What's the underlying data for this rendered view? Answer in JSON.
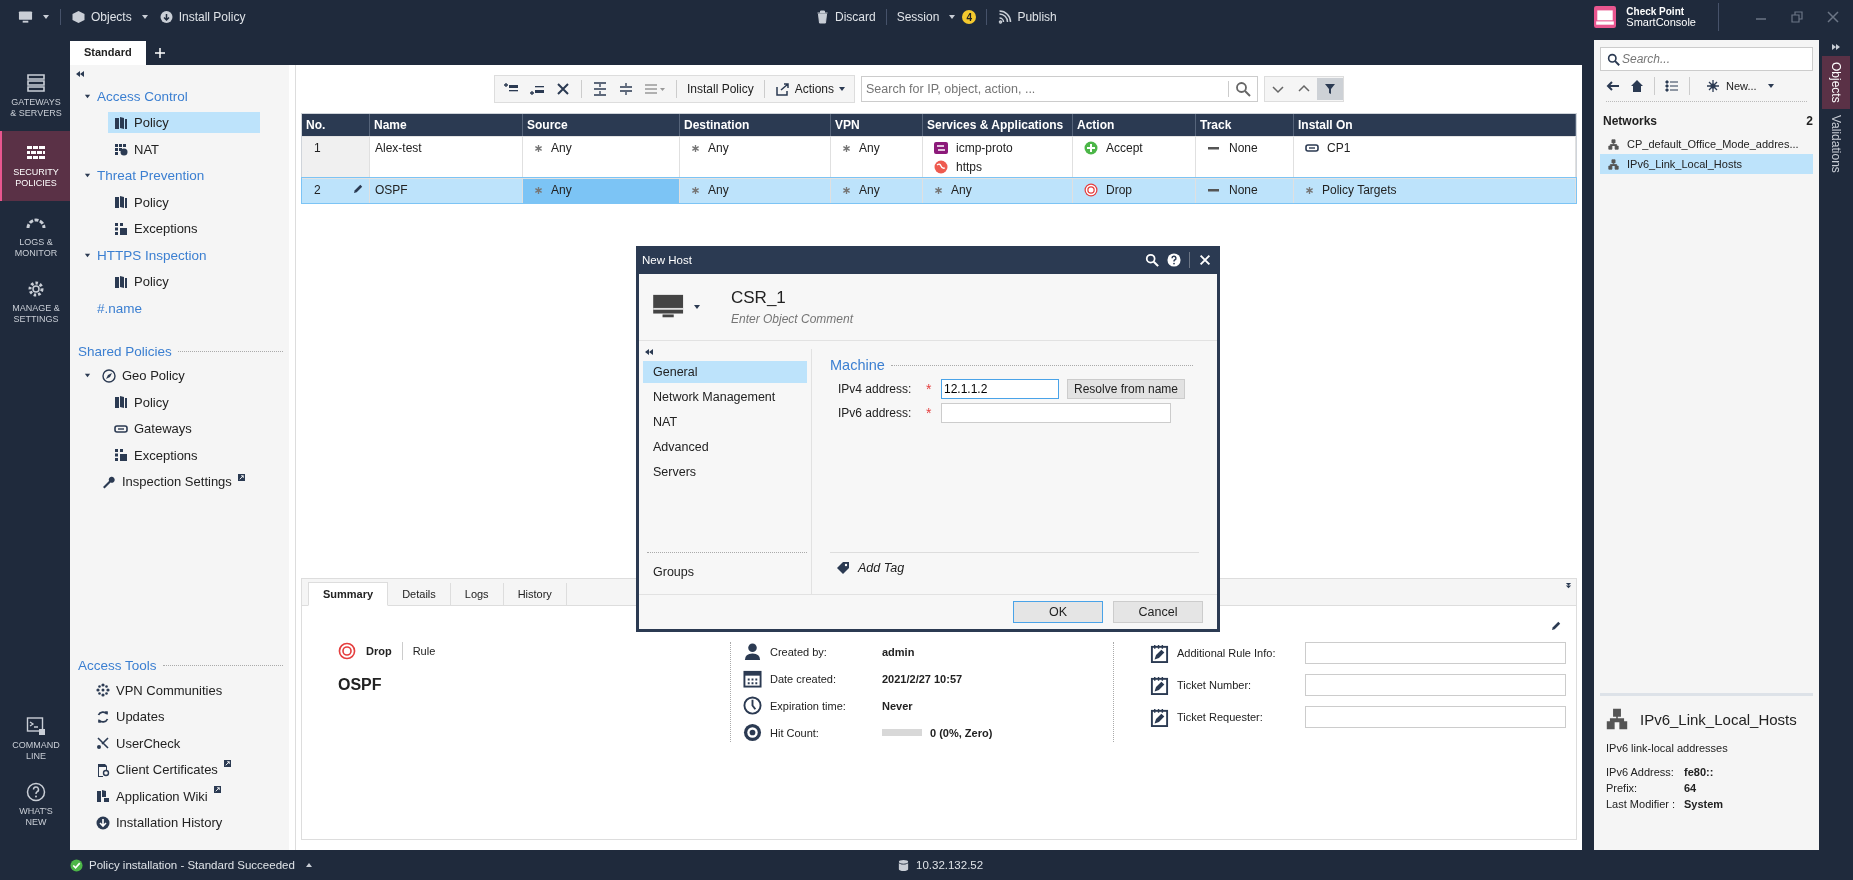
{
  "top_bar": {
    "objects_menu": "Objects",
    "install_policy": "Install Policy",
    "discard": "Discard",
    "session": "Session",
    "session_badge": "4",
    "publish": "Publish",
    "brand_line1": "Check Point",
    "brand_line2": "SmartConsole"
  },
  "policy_tabs": [
    {
      "label": "Standard",
      "selected": true
    }
  ],
  "nav_top": [
    {
      "kind": "gateways",
      "lines": [
        "GATEWAYS",
        "& SERVERS"
      ],
      "selected": false
    },
    {
      "kind": "policies",
      "lines": [
        "SECURITY",
        "POLICIES"
      ],
      "selected": true
    },
    {
      "kind": "logs",
      "lines": [
        "LOGS &",
        "MONITOR"
      ],
      "selected": false
    },
    {
      "kind": "manage",
      "lines": [
        "MANAGE &",
        "SETTINGS"
      ],
      "selected": false
    }
  ],
  "nav_bottom": [
    {
      "kind": "cmd",
      "lines": [
        "COMMAND",
        "LINE"
      ],
      "selected": false
    },
    {
      "kind": "whatsnew",
      "lines": [
        "WHAT'S",
        "NEW"
      ],
      "selected": false
    }
  ],
  "policy_tree": [
    {
      "label": "Access Control",
      "expanded": true,
      "selected": false,
      "children": [
        {
          "label": "Policy",
          "kind": "policy",
          "selected": true
        },
        {
          "label": "NAT",
          "kind": "nat",
          "selected": false
        }
      ]
    },
    {
      "label": "Threat Prevention",
      "expanded": true,
      "selected": false,
      "children": [
        {
          "label": "Policy",
          "kind": "policy",
          "selected": false
        },
        {
          "label": "Exceptions",
          "kind": "exceptions",
          "selected": false
        }
      ]
    },
    {
      "label": "HTTPS Inspection",
      "expanded": true,
      "selected": false,
      "children": [
        {
          "label": "Policy",
          "kind": "policy",
          "selected": false
        }
      ]
    },
    {
      "label": "#.name",
      "selected": false
    }
  ],
  "shared_policies": {
    "title": "Shared Policies",
    "items": [
      {
        "label": "Geo Policy",
        "kind": "geo",
        "expanded": true,
        "selected": false,
        "children": [
          {
            "label": "Policy",
            "kind": "policy",
            "selected": false
          },
          {
            "label": "Gateways",
            "kind": "gateways",
            "selected": false
          },
          {
            "label": "Exceptions",
            "kind": "exceptions",
            "selected": false
          }
        ]
      },
      {
        "label": "Inspection Settings",
        "kind": "wrench",
        "external": true,
        "selected": false
      }
    ]
  },
  "access_tools": {
    "title": "Access Tools",
    "items": [
      {
        "label": "VPN Communities",
        "kind": "vpn",
        "external": false
      },
      {
        "label": "Updates",
        "kind": "updates",
        "external": false
      },
      {
        "label": "UserCheck",
        "kind": "usercheck",
        "external": false
      },
      {
        "label": "Client Certificates",
        "kind": "certs",
        "external": true
      },
      {
        "label": "Application Wiki",
        "kind": "wiki",
        "external": true
      },
      {
        "label": "Installation History",
        "kind": "history",
        "external": false
      }
    ]
  },
  "toolbar": {
    "install_policy": "Install Policy",
    "actions": "Actions",
    "search_placeholder": "Search for IP, object, action, ..."
  },
  "table": {
    "columns": [
      "No.",
      "Name",
      "Source",
      "Destination",
      "VPN",
      "Services & Applications",
      "Action",
      "Track",
      "Install On"
    ],
    "rows": [
      {
        "no": "1",
        "name": "Alex-test",
        "source": {
          "selected": false,
          "items": [
            {
              "label": "Any",
              "kind": "any"
            }
          ]
        },
        "destination": {
          "selected": false,
          "items": [
            {
              "label": "Any",
              "kind": "any"
            }
          ]
        },
        "vpn": {
          "selected": false,
          "items": [
            {
              "label": "Any",
              "kind": "any"
            }
          ]
        },
        "services": {
          "selected": false,
          "items": [
            {
              "label": "icmp-proto",
              "kind": "icmp"
            },
            {
              "label": "https",
              "kind": "web"
            }
          ]
        },
        "action": {
          "selected": false,
          "items": [
            {
              "label": "Accept",
              "kind": "accept"
            }
          ]
        },
        "track": {
          "selected": false,
          "items": [
            {
              "label": "None",
              "kind": "none"
            }
          ]
        },
        "install_on": {
          "selected": false,
          "items": [
            {
              "label": "CP1",
              "kind": "gateway"
            }
          ]
        },
        "selected": false,
        "editing": false
      },
      {
        "no": "2",
        "name": "OSPF",
        "source": {
          "selected": true,
          "items": [
            {
              "label": "Any",
              "kind": "any"
            }
          ]
        },
        "destination": {
          "selected": false,
          "items": [
            {
              "label": "Any",
              "kind": "any"
            }
          ]
        },
        "vpn": {
          "selected": false,
          "items": [
            {
              "label": "Any",
              "kind": "any"
            }
          ]
        },
        "services": {
          "selected": false,
          "items": [
            {
              "label": "Any",
              "kind": "any"
            }
          ]
        },
        "action": {
          "selected": false,
          "items": [
            {
              "label": "Drop",
              "kind": "drop"
            }
          ]
        },
        "track": {
          "selected": false,
          "items": [
            {
              "label": "None",
              "kind": "none"
            }
          ]
        },
        "install_on": {
          "selected": false,
          "items": [
            {
              "label": "Policy Targets",
              "kind": "any"
            }
          ]
        },
        "selected": true,
        "editing": true
      }
    ]
  },
  "bottom_panel": {
    "tabs": [
      {
        "label": "Summary",
        "selected": true
      },
      {
        "label": "Details",
        "selected": false
      },
      {
        "label": "Logs",
        "selected": false
      },
      {
        "label": "History",
        "selected": false
      }
    ],
    "action": {
      "label": "Drop",
      "kind": "drop"
    },
    "rule_label": "Rule",
    "rule_name": "OSPF",
    "info": [
      {
        "kind": "user",
        "label": "Created by:",
        "value": "admin"
      },
      {
        "kind": "calendar",
        "label": "Date created:",
        "value": "2021/2/27 10:57"
      },
      {
        "kind": "clock",
        "label": "Expiration time:",
        "value": "Never"
      },
      {
        "kind": "hits",
        "label": "Hit Count:",
        "value": "0 (0%, Zero)",
        "level": 0
      }
    ],
    "custom_fields": [
      {
        "label": "Additional Rule Info:"
      },
      {
        "label": "Ticket Number:"
      },
      {
        "label": "Ticket Requester:"
      }
    ]
  },
  "dialog": {
    "title": "New Host",
    "name": "CSR_1",
    "comment_placeholder": "Enter Object Comment",
    "nav": [
      {
        "label": "General",
        "selected": true
      },
      {
        "label": "Network Management",
        "selected": false
      },
      {
        "label": "NAT",
        "selected": false
      },
      {
        "label": "Advanced",
        "selected": false
      },
      {
        "label": "Servers",
        "selected": false
      }
    ],
    "nav_bottom": [
      {
        "label": "Groups",
        "selected": false
      }
    ],
    "section": "Machine",
    "fields": [
      {
        "label": "IPv4 address:",
        "required_mark": "*",
        "value": "12.1.1.2",
        "focused": true,
        "action": "Resolve from name"
      },
      {
        "label": "IPv6 address:",
        "required_mark": "*",
        "focused": false
      }
    ],
    "add_tag": "Add Tag",
    "buttons": [
      {
        "label": "OK",
        "default": true
      },
      {
        "label": "Cancel",
        "default": false
      }
    ]
  },
  "objects_panel": {
    "search_placeholder": "Search...",
    "new_button": "New...",
    "group": {
      "title": "Networks",
      "count": "2",
      "items": [
        {
          "label": "CP_default_Office_Mode_addres...",
          "selected": false
        },
        {
          "label": "IPv6_Link_Local_Hosts",
          "selected": true
        }
      ]
    },
    "details": {
      "title": "IPv6_Link_Local_Hosts",
      "description": "IPv6 link-local addresses",
      "properties": [
        {
          "label": "IPv6 Address:",
          "value": "fe80::"
        },
        {
          "label": "Prefix:",
          "value": "64"
        },
        {
          "label": "Last Modifier :",
          "value": "System"
        }
      ]
    }
  },
  "side_tabs": [
    {
      "label": "Objects",
      "selected": true
    },
    {
      "label": "Validations",
      "selected": false
    }
  ],
  "status_bar": {
    "message": "Policy installation - Standard Succeeded",
    "server": "10.32.132.52"
  }
}
